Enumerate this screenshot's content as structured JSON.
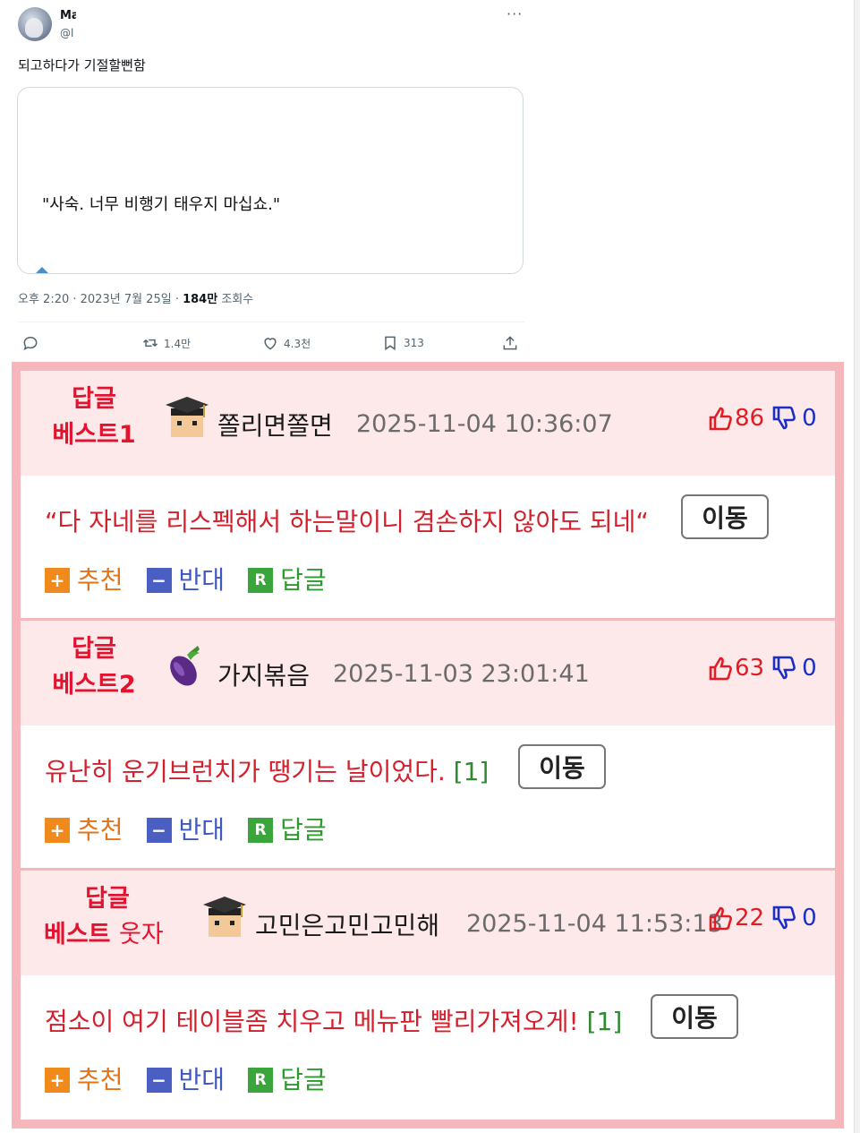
{
  "tweet": {
    "user_name": "Ma",
    "user_handle": "@l",
    "text": "되고하다가 기절할뻔함",
    "quote_text": "\"사숙. 너무 비행기 태우지 마십쇼.\"",
    "meta_time": "오후 2:20 · 2023년 7월 25일 · ",
    "meta_views_count": "184만",
    "meta_views_label": " 조회수",
    "retweets": "1.4만",
    "likes": "4.3천",
    "bookmarks": "313"
  },
  "best_comments": [
    {
      "label_top": "답글",
      "label_bottom": "베스트1",
      "nickname": "쫄리면쫄면",
      "date": "2025-11-04 10:36:07",
      "upvotes": "86",
      "downvotes": "0",
      "content": "“다 자네를 리스펙해서 하는말이니 겸손하지 않아도 되네“",
      "reply_count": "",
      "move_label": "이동"
    },
    {
      "label_top": "답글",
      "label_bottom": "베스트2",
      "nickname": "가지볶음",
      "date": "2025-11-03 23:01:41",
      "upvotes": "63",
      "downvotes": "0",
      "content": "유난히 운기브런치가 땡기는 날이었다.",
      "reply_count": "[1]",
      "move_label": "이동"
    },
    {
      "label_top": "답글",
      "label_bottom_a": "베스트",
      "label_bottom_b": "웃자",
      "nickname": "고민은고민고민해",
      "date": "2025-11-04 11:53:13",
      "upvotes": "22",
      "downvotes": "0",
      "content": "점소이 여기 테이블좀 치우고 메뉴판 빨리가져오게!",
      "reply_count": "[1]",
      "move_label": "이동"
    }
  ],
  "actions": {
    "recommend": "추천",
    "oppose": "반대",
    "reply": "답글",
    "recommend_icon": "+",
    "oppose_icon": "−",
    "reply_icon": "R"
  },
  "colors": {
    "panel_border": "#f6b7bc",
    "head_bg": "#fde8ea",
    "content_red": "#d3202c",
    "upvote_red": "#e31b23",
    "downvote_blue": "#1b2fc4"
  },
  "icons": {
    "level_icon": "graduate-cap-face-icon",
    "eggplant": "eggplant-icon",
    "thumbs_up": "thumbs-up-icon",
    "thumbs_down": "thumbs-down-icon"
  }
}
